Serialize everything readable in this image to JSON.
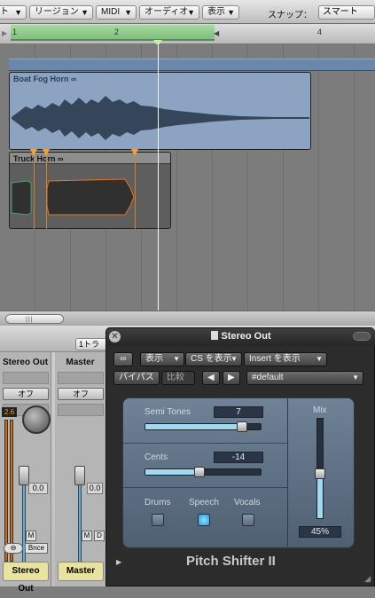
{
  "menubar": {
    "items": [
      "ト",
      "リージョン",
      "MIDI",
      "オーディオ",
      "表示"
    ],
    "snap_label": "スナップ：",
    "snap_value": "スマート"
  },
  "ruler": {
    "bars": [
      "1",
      "2",
      "4"
    ]
  },
  "regions": {
    "boat": "Boat Fog Horn",
    "truck": "Truck Horn"
  },
  "mixer": {
    "track_button": "1トラ",
    "strips": [
      {
        "name": "Stereo Out",
        "off": "オフ",
        "level": "2.6",
        "volume": "0.0",
        "tab": "Stereo Out",
        "bounce": "Bnce",
        "m": "M"
      },
      {
        "name": "Master",
        "off": "オフ",
        "volume": "0.0",
        "tab": "Master",
        "m": "M",
        "d": "D"
      }
    ]
  },
  "plugin": {
    "title": "Stereo Out",
    "view_menu": "表示",
    "cs_menu": "CS を表示",
    "insert_menu": "Insert を表示",
    "bypass": "バイパス",
    "compare": "比較",
    "prev": "◀",
    "next": "▶",
    "preset": "#default",
    "semi_tones_label": "Semi Tones",
    "semi_tones_value": "7",
    "semi_tones_level": 0.84,
    "cents_label": "Cents",
    "cents_value": "-14",
    "cents_level": 0.47,
    "drums": "Drums",
    "speech": "Speech",
    "vocals": "Vocals",
    "drums_on": false,
    "speech_on": true,
    "vocals_on": false,
    "mix_label": "Mix",
    "mix_value": "45%",
    "mix_level": 0.45,
    "name": "Pitch Shifter II",
    "colors": {
      "accent": "#a4d8ee",
      "panel": "#5e7185"
    }
  }
}
